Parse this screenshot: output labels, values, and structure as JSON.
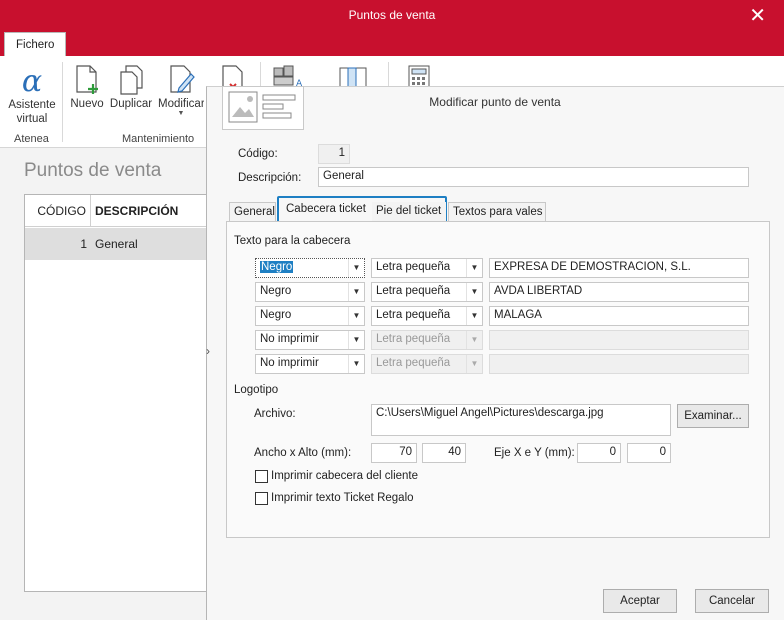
{
  "window": {
    "title": "Puntos de venta",
    "close": "✕"
  },
  "ribbon": {
    "tab": "Fichero",
    "buttons": {
      "asistente": "Asistente virtual",
      "nuevo": "Nuevo",
      "duplicar": "Duplicar",
      "modificar": "Modificar"
    },
    "groups": {
      "atenea": "Atenea",
      "mantenimiento": "Mantenimiento"
    }
  },
  "list": {
    "title": "Puntos de venta",
    "columns": [
      "CÓDIGO",
      "DESCRIPCIÓN"
    ],
    "rows": [
      {
        "codigo": "1",
        "descripcion": "General"
      }
    ]
  },
  "dialog": {
    "title": "Modificar punto de venta",
    "codigo_label": "Código:",
    "codigo_value": "1",
    "descripcion_label": "Descripción:",
    "descripcion_value": "General",
    "tabs": [
      "General",
      "Cabecera ticket",
      "Pie del ticket",
      "Textos para vales"
    ],
    "active_tab": "Cabecera ticket",
    "texto_cabecera_label": "Texto para la cabecera",
    "cabecera_rows": [
      {
        "color": "Negro",
        "size": "Letra pequeña",
        "text": "EXPRESA DE DEMOSTRACION, S.L."
      },
      {
        "color": "Negro",
        "size": "Letra pequeña",
        "text": "AVDA LIBERTAD"
      },
      {
        "color": "Negro",
        "size": "Letra pequeña",
        "text": "MALAGA"
      },
      {
        "color": "No imprimir",
        "size": "Letra pequeña",
        "text": ""
      },
      {
        "color": "No imprimir",
        "size": "Letra pequeña",
        "text": ""
      }
    ],
    "logotipo_label": "Logotipo",
    "archivo_label": "Archivo:",
    "archivo_value": "C:\\Users\\Miguel Angel\\Pictures\\descarga.jpg",
    "examinar": "Examinar...",
    "ancho_alto_label": "Ancho x Alto (mm):",
    "ancho": "70",
    "alto": "40",
    "eje_label": "Eje X e Y (mm):",
    "eje_x": "0",
    "eje_y": "0",
    "chk_cabecera_cliente": "Imprimir cabecera del cliente",
    "chk_ticket_regalo": "Imprimir texto Ticket Regalo",
    "aceptar": "Aceptar",
    "cancelar": "Cancelar"
  },
  "colors": {
    "brand": "#c8102e",
    "focus": "#1e7fc3"
  }
}
